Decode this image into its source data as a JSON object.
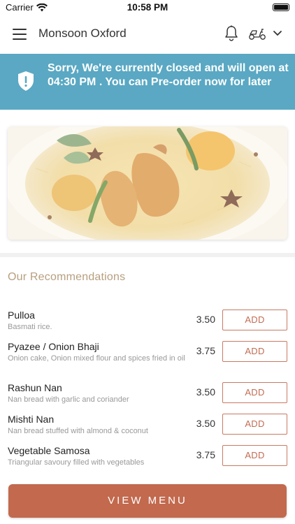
{
  "status_bar": {
    "carrier": "Carrier",
    "time": "10:58 PM"
  },
  "header": {
    "store_name": "Monsoon Oxford",
    "icons": [
      "menu-icon",
      "bell-icon",
      "scooter-icon",
      "chevron-down-icon"
    ]
  },
  "banner": {
    "message": "Sorry, We're currently closed and will open at 04:30 PM . You can Pre-order now for later",
    "icon": "shield-alert-icon",
    "color": "#5aa8c3"
  },
  "hero": {
    "image": "biryani-dish"
  },
  "recommendations": {
    "title": "Our Recommendations",
    "add_label": "ADD",
    "items": [
      {
        "name": "Pulloa",
        "description": "Basmati rice.",
        "price": "3.50"
      },
      {
        "name": "Pyazee / Onion Bhaji",
        "description": "Onion cake, Onion mixed flour and spices fried in oil",
        "price": "3.75"
      },
      {
        "name": "Rashun Nan",
        "description": "Nan bread with garlic and coriander",
        "price": "3.50"
      },
      {
        "name": "Mishti Nan",
        "description": "Nan bread stuffed with almond & coconut",
        "price": "3.50"
      },
      {
        "name": "Vegetable Samosa",
        "description": "Triangular savoury filled with vegetables",
        "price": "3.75"
      }
    ]
  },
  "footer": {
    "view_menu_label": "VIEW MENU",
    "accent_color": "#c2694e"
  }
}
